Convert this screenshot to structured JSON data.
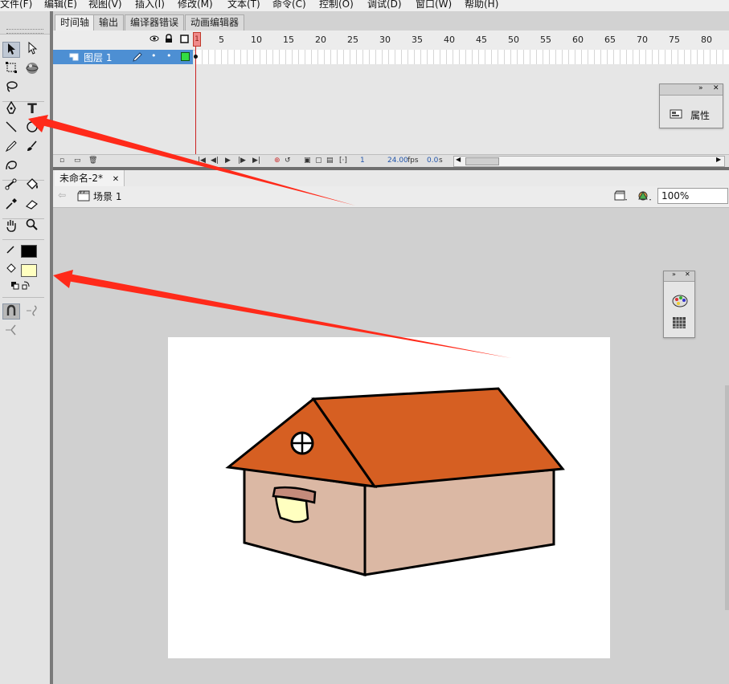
{
  "menu": [
    "文件(F)",
    "编辑(E)",
    "视图(V)",
    "插入(I)",
    "修改(M)",
    "文本(T)",
    "命令(C)",
    "控制(O)",
    "调试(D)",
    "窗口(W)",
    "帮助(H)"
  ],
  "panel_tabs": [
    "时间轴",
    "输出",
    "编译器错误",
    "动画编辑器"
  ],
  "timeline": {
    "frame_numbers": [
      "1",
      "5",
      "10",
      "15",
      "20",
      "25",
      "30",
      "35",
      "40",
      "45",
      "50",
      "55",
      "60",
      "65",
      "70",
      "75",
      "80"
    ],
    "playhead_frame": "1",
    "layer_name": "图层 1",
    "current_frame": "1",
    "fps": "24.00",
    "fps_unit": "fps",
    "elapsed": "0.0",
    "elapsed_unit": "s"
  },
  "properties_panel": {
    "label": "属性"
  },
  "document_tab": "未命名-2*",
  "scene_label": "场景 1",
  "zoom": "100%",
  "colors": {
    "stroke_swatch": "#000000",
    "fill_swatch": "#ffffc0",
    "roof": "#d65f22",
    "wall": "#dbb8a4",
    "arrow": "#ff2a1a",
    "layer_selected": "#4d8fd3"
  }
}
